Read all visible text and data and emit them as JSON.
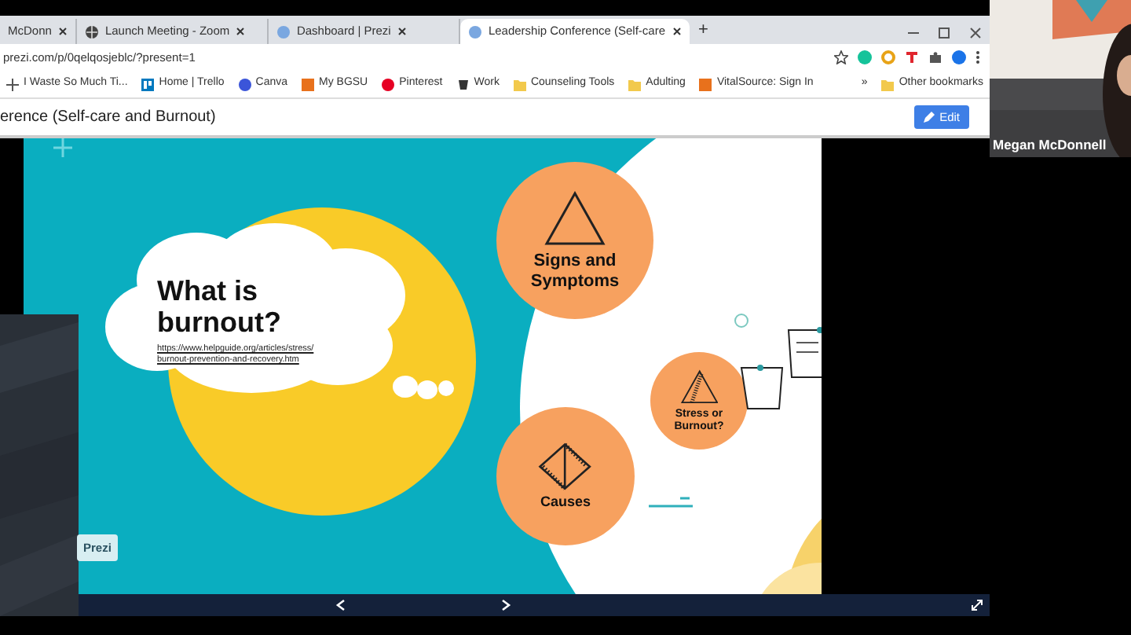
{
  "browser": {
    "tabs": [
      {
        "title": "McDonn",
        "selected": false
      },
      {
        "title": "Launch Meeting - Zoom",
        "selected": false
      },
      {
        "title": "Dashboard | Prezi",
        "selected": false
      },
      {
        "title": "Leadership Conference (Self-care",
        "selected": true
      }
    ],
    "new_tab": "+",
    "address": "prezi.com/p/0qelqosjeblc/?present=1",
    "extensions": [
      {
        "kind": "grammar"
      },
      {
        "kind": "ring"
      },
      {
        "kind": "tp"
      },
      {
        "kind": "puzzle"
      },
      {
        "kind": "avatar"
      }
    ],
    "bookmarks": [
      {
        "label": "I Waste So Much Ti..."
      },
      {
        "label": "Home | Trello"
      },
      {
        "label": "Canva"
      },
      {
        "label": "My BGSU"
      },
      {
        "label": "Pinterest"
      },
      {
        "label": "Work"
      },
      {
        "label": "Counseling Tools"
      },
      {
        "label": "Adulting"
      },
      {
        "label": "VitalSource: Sign In"
      }
    ],
    "more_bookmarks": "»",
    "other_bookmarks": "Other bookmarks"
  },
  "prezi": {
    "title": "erence (Self-care and Burnout)",
    "edit_button": "Edit",
    "slide": {
      "heading": "What is burnout?",
      "link": "https://www.helpguide.org/articles/stress/ burnout-prevention-and-recovery.htm",
      "topics": [
        {
          "label": "Signs and Symptoms",
          "kind": "triangle"
        },
        {
          "label": "Causes",
          "kind": "prism"
        },
        {
          "label": "Stress or Burnout?",
          "kind": "ladder"
        }
      ]
    },
    "badge": "Prezi"
  },
  "participant": {
    "name": "Megan McDonnell"
  }
}
